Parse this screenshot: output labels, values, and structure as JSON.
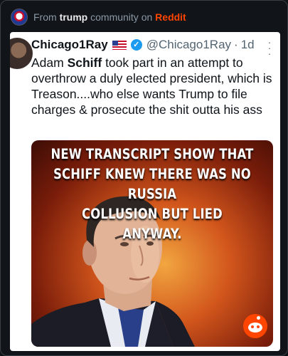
{
  "source": {
    "prefix": "From",
    "community": "trump",
    "middle": "community on",
    "platform": "Reddit"
  },
  "post": {
    "author_name": "Chicago1Ray",
    "flag_icon": "us-flag-icon",
    "verified_icon": "verified-badge-icon",
    "handle": "@Chicago1Ray",
    "separator": "·",
    "time": "1d",
    "text_segments": [
      "Adam ",
      "Schiff",
      " took part in an attempt to overthrow a duly elected president, which is Treason....who else wants Trump to file charges & prosecute the shit outta his ass"
    ],
    "image": {
      "caption_lines": [
        "NEW TRANSCRIPT SHOW THAT",
        "SCHIFF KNEW THERE WAS NO RUSSIA",
        "COLLUSION BUT LIED ANYWAY."
      ],
      "watermark_icon": "reddit-snoo-icon"
    }
  },
  "colors": {
    "reddit": "#ff4500",
    "verified": "#1d9bf0"
  }
}
